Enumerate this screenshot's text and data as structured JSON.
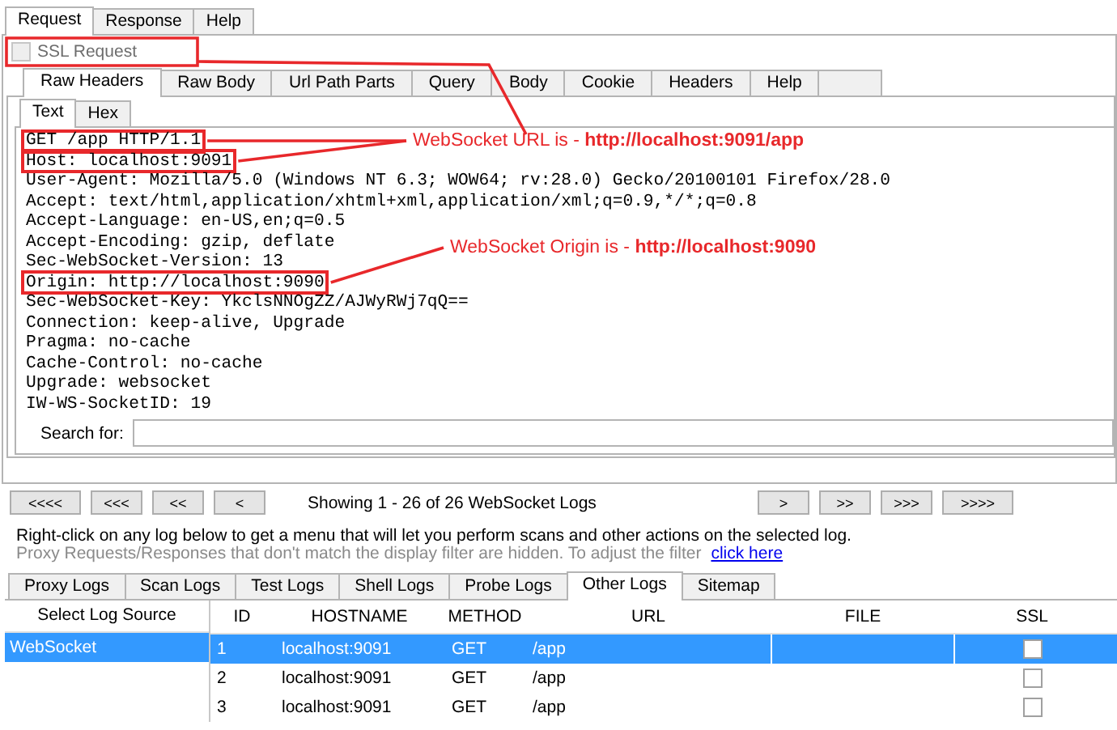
{
  "top_tabs": [
    {
      "label": "Request",
      "selected": true
    },
    {
      "label": "Response",
      "selected": false
    },
    {
      "label": "Help",
      "selected": false
    }
  ],
  "ssl_request": {
    "label": "SSL Request",
    "checked": false,
    "disabled": true
  },
  "sub_tabs": [
    {
      "label": "Raw Headers",
      "selected": true
    },
    {
      "label": "Raw Body",
      "selected": false
    },
    {
      "label": "Url Path Parts",
      "selected": false
    },
    {
      "label": "Query",
      "selected": false
    },
    {
      "label": "Body",
      "selected": false
    },
    {
      "label": "Cookie",
      "selected": false
    },
    {
      "label": "Headers",
      "selected": false
    },
    {
      "label": "Help",
      "selected": false
    }
  ],
  "view_tabs": [
    {
      "label": "Text",
      "selected": true
    },
    {
      "label": "Hex",
      "selected": false
    }
  ],
  "raw_lines": [
    {
      "text": "GET /app HTTP/1.1",
      "highlighted": true
    },
    {
      "text": "Host: localhost:9091",
      "highlighted": true
    },
    {
      "text": "User-Agent: Mozilla/5.0 (Windows NT 6.3; WOW64; rv:28.0) Gecko/20100101 Firefox/28.0",
      "highlighted": false
    },
    {
      "text": "Accept: text/html,application/xhtml+xml,application/xml;q=0.9,*/*;q=0.8",
      "highlighted": false
    },
    {
      "text": "Accept-Language: en-US,en;q=0.5",
      "highlighted": false
    },
    {
      "text": "Accept-Encoding: gzip, deflate",
      "highlighted": false
    },
    {
      "text": "Sec-WebSocket-Version: 13",
      "highlighted": false
    },
    {
      "text": "Origin: http://localhost:9090",
      "highlighted": true
    },
    {
      "text": "Sec-WebSocket-Key: YkclsNNOgZZ/AJWyRWj7qQ==",
      "highlighted": false
    },
    {
      "text": "Connection: keep-alive, Upgrade",
      "highlighted": false
    },
    {
      "text": "Pragma: no-cache",
      "highlighted": false
    },
    {
      "text": "Cache-Control: no-cache",
      "highlighted": false
    },
    {
      "text": "Upgrade: websocket",
      "highlighted": false
    },
    {
      "text": "IW-WS-SocketID: 19",
      "highlighted": false
    }
  ],
  "annotations": [
    {
      "text": "WebSocket URL is - **http://localhost:9091/app**"
    },
    {
      "text": "WebSocket Origin is - **http://localhost:9090**"
    }
  ],
  "search": {
    "label": "Search for:"
  },
  "pager": {
    "back_buttons": [
      "<<<<",
      "<<<",
      "<<",
      "<"
    ],
    "status": "Showing 1 - 26 of  26 WebSocket Logs",
    "forward_buttons": [
      ">",
      ">>",
      ">>>",
      ">>>>"
    ]
  },
  "hint": "Right-click on any log below to get a menu that will let you perform scans and other actions on the selected log.",
  "filter_note": {
    "text": "Proxy Requests/Responses that don't match the display filter are hidden. To adjust the filter",
    "link": "click here"
  },
  "log_tabs": [
    {
      "label": "Proxy Logs",
      "selected": false
    },
    {
      "label": "Scan Logs",
      "selected": false
    },
    {
      "label": "Test Logs",
      "selected": false
    },
    {
      "label": "Shell Logs",
      "selected": false
    },
    {
      "label": "Probe Logs",
      "selected": false
    },
    {
      "label": "Other Logs",
      "selected": true
    },
    {
      "label": "Sitemap",
      "selected": false
    }
  ],
  "log_source": {
    "heading": "Select Log Source",
    "items": [
      {
        "label": "WebSocket",
        "selected": true
      }
    ]
  },
  "table": {
    "columns": [
      "ID",
      "HOSTNAME",
      "METHOD",
      "URL",
      "FILE",
      "SSL"
    ],
    "rows": [
      {
        "id": "1",
        "hostname": "localhost:9091",
        "method": "GET",
        "url": "/app",
        "ssl": false,
        "selected": true
      },
      {
        "id": "2",
        "hostname": "localhost:9091",
        "method": "GET",
        "url": "/app",
        "ssl": false,
        "selected": false
      },
      {
        "id": "3",
        "hostname": "localhost:9091",
        "method": "GET",
        "url": "/app",
        "ssl": false,
        "selected": false
      }
    ]
  }
}
